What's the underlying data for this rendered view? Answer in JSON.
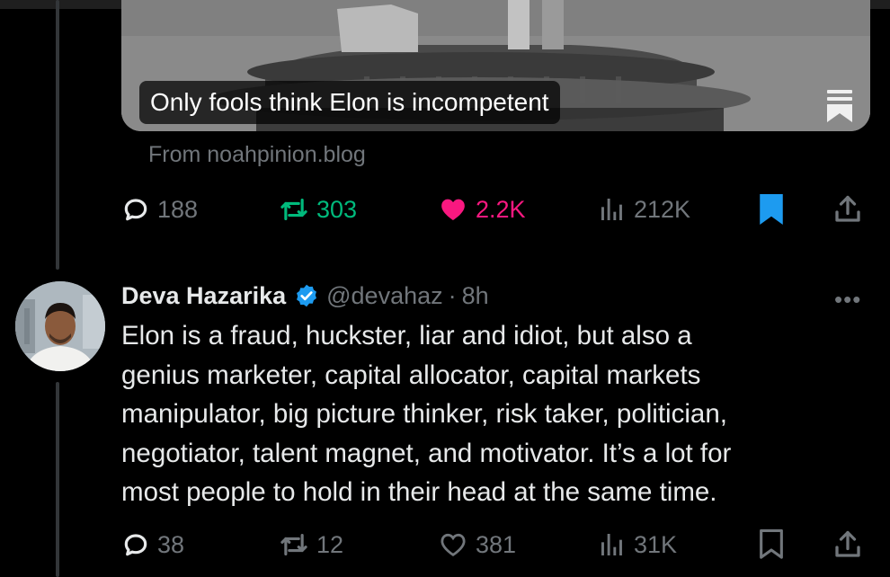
{
  "prev_tweet": {
    "card": {
      "headline": "Only fools think Elon is incompetent",
      "source": "From noahpinion.blog"
    },
    "stats": {
      "replies": "188",
      "reposts": "303",
      "likes": "2.2K",
      "views": "212K"
    },
    "liked": true,
    "reposted": true,
    "bookmarked": true
  },
  "tweet": {
    "author": "Deva Hazarika",
    "handle": "@devahaz",
    "separator": "·",
    "time": "8h",
    "more": "•••",
    "text_lines": [
      "Elon is a fraud, huckster, liar and idiot, but also a",
      "genius marketer, capital allocator, capital markets",
      "manipulator, big picture thinker, risk taker, politician,",
      "negotiator, talent magnet, and motivator. It’s a lot for",
      "most people to hold in their head at the same time."
    ],
    "stats": {
      "replies": "38",
      "reposts": "12",
      "likes": "381",
      "views": "31K"
    }
  },
  "colors": {
    "accent": "#1d9bf0",
    "like": "#f91880",
    "repost": "#00ba7c",
    "muted": "#71767b",
    "text": "#e7e9ea",
    "bg": "#000000"
  },
  "icons": [
    "reply-icon",
    "repost-icon",
    "like-icon",
    "views-icon",
    "bookmark-icon",
    "share-icon",
    "verified-badge-icon",
    "article-icon"
  ]
}
